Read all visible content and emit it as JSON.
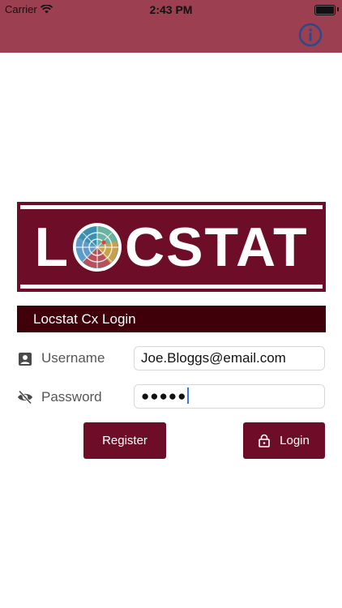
{
  "status_bar": {
    "carrier": "Carrier",
    "time": "2:43 PM"
  },
  "header": {
    "info_icon": "info-circle-icon"
  },
  "logo": {
    "text_left": "L",
    "text_right": "CSTAT"
  },
  "login": {
    "title": "Locstat Cx Login",
    "username_label": "Username",
    "username_value": "Joe.Bloggs@email.com",
    "password_label": "Password",
    "password_value": "●●●●●",
    "register_label": "Register",
    "login_label": "Login"
  },
  "colors": {
    "header_bg": "#9b3f51",
    "brand": "#6e0d27",
    "title_bar_bg": "#3f0009",
    "info_icon": "#2b4a8c"
  }
}
